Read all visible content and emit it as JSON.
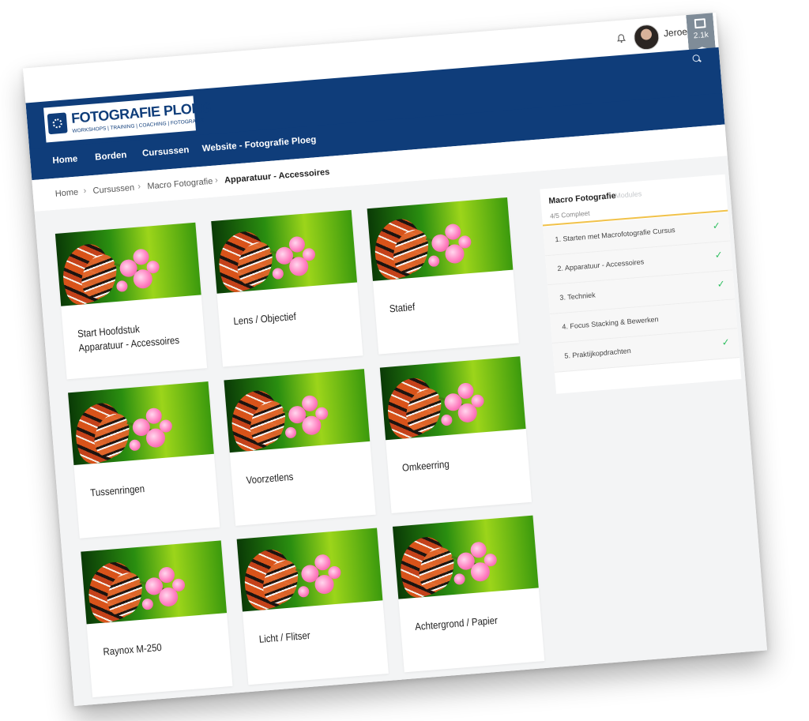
{
  "topbar": {
    "username": "Jeroen",
    "badge_count": "2.1k"
  },
  "header": {
    "logo_title": "FOTOGRAFIE PLOEG",
    "logo_subtitle": "WORKSHOPS | TRAINING | COACHING | FOTOGRAFIE"
  },
  "nav": {
    "items": [
      "Home",
      "Borden",
      "Cursussen",
      "Website - Fotografie Ploeg"
    ]
  },
  "breadcrumb": {
    "items": [
      "Home",
      "Cursussen",
      "Macro Fotografie",
      "Apparatuur - Accessoires"
    ],
    "separator": "›"
  },
  "cards": [
    "Start Hoofdstuk Apparatuur - Accessoires",
    "Lens / Objectief",
    "Statief",
    "Tussenringen",
    "Voorzetlens",
    "Omkeerring",
    "Raynox M-250",
    "Licht / Flitser",
    "Achtergrond / Papier"
  ],
  "panel": {
    "title": "Macro Fotografie",
    "subtitle": "Modules",
    "progress": "4/5 Compleet",
    "modules": [
      {
        "label": "1. Starten met Macrofotografie Cursus",
        "done": true
      },
      {
        "label": "2. Apparatuur - Accessoires",
        "done": true
      },
      {
        "label": "3. Techniek",
        "done": true
      },
      {
        "label": "4. Focus Stacking & Bewerken",
        "done": false
      },
      {
        "label": "5. Praktijkopdrachten",
        "done": true
      }
    ],
    "check_symbol": "✓"
  },
  "colors": {
    "brand": "#0f3d7a",
    "accent": "#f1c24a",
    "check": "#2fbf60",
    "background": "#f3f4f5"
  }
}
